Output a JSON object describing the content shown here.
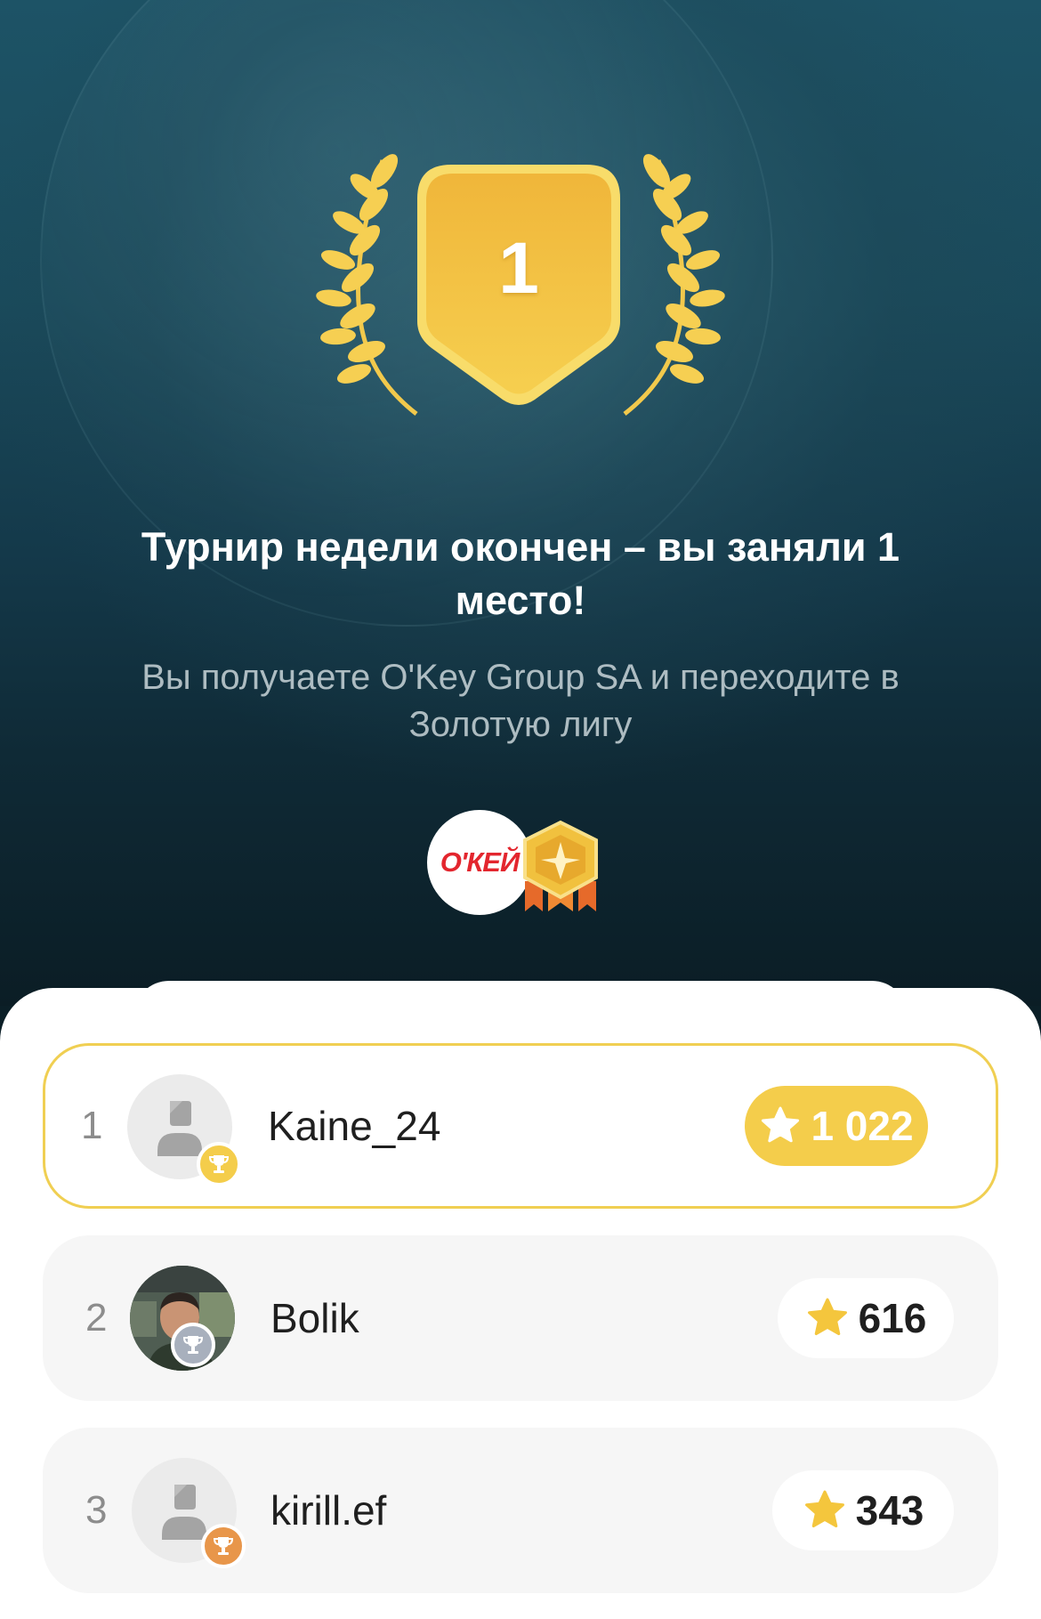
{
  "result": {
    "place_number": "1",
    "title": "Турнир недели окончен – вы заняли 1 место!",
    "subtitle": "Вы получаете O'Key Group SA и переходите в Золотую лигу",
    "partner_logo_text": "О'КЕЙ"
  },
  "leaderboard": [
    {
      "rank": "1",
      "name": "Kaine_24",
      "score": "1 022",
      "cup": "gold",
      "avatar": "default",
      "is_current_user": true
    },
    {
      "rank": "2",
      "name": "Bolik",
      "score": "616",
      "cup": "silver",
      "avatar": "photo",
      "is_current_user": false
    },
    {
      "rank": "3",
      "name": "kirill.ef",
      "score": "343",
      "cup": "bronze",
      "avatar": "default",
      "is_current_user": false
    }
  ],
  "colors": {
    "gold": "#f4cd4b",
    "highlight_border": "#f0cf52",
    "silver_cup": "#a8b0bd",
    "bronze_cup": "#e8964a",
    "okey_red": "#e3262e"
  },
  "icons": [
    "laurel-wreath-icon",
    "place-medal-icon",
    "league-badge-icon",
    "trophy-cup-icon",
    "star-icon",
    "user-placeholder-icon"
  ]
}
